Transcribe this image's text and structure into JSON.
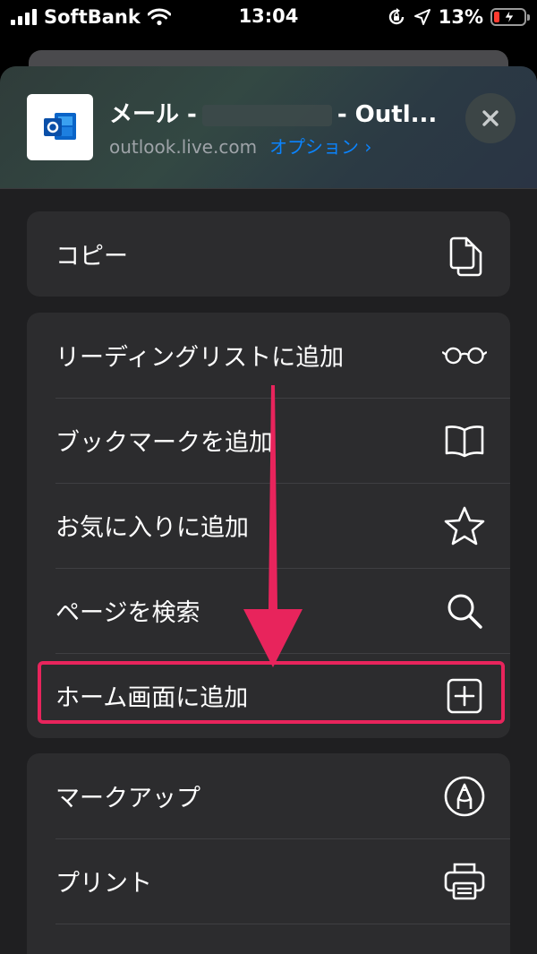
{
  "status_bar": {
    "carrier": "SoftBank",
    "time": "13:04",
    "battery_percent": "13%",
    "icons": [
      "signal-icon",
      "wifi-icon",
      "orientation-lock-icon",
      "location-arrow-icon",
      "battery-charging-icon"
    ]
  },
  "header": {
    "title_prefix": "メール -",
    "title_suffix": "- Outl...",
    "url": "outlook.live.com",
    "options_label": "オプション ›",
    "app_icon": "outlook-icon",
    "close_icon": "close-icon"
  },
  "actions": {
    "group1": [
      {
        "label": "コピー",
        "icon": "copy-icon"
      }
    ],
    "group2": [
      {
        "label": "リーディングリストに追加",
        "icon": "glasses-icon"
      },
      {
        "label": "ブックマークを追加",
        "icon": "book-icon"
      },
      {
        "label": "お気に入りに追加",
        "icon": "star-icon"
      },
      {
        "label": "ページを検索",
        "icon": "search-icon"
      },
      {
        "label": "ホーム画面に追加",
        "icon": "plus-square-icon"
      }
    ],
    "group3": [
      {
        "label": "マークアップ",
        "icon": "markup-icon"
      },
      {
        "label": "プリント",
        "icon": "printer-icon"
      }
    ]
  },
  "annotation": {
    "color": "#e8245c",
    "highlighted_item": "ホーム画面に追加"
  }
}
